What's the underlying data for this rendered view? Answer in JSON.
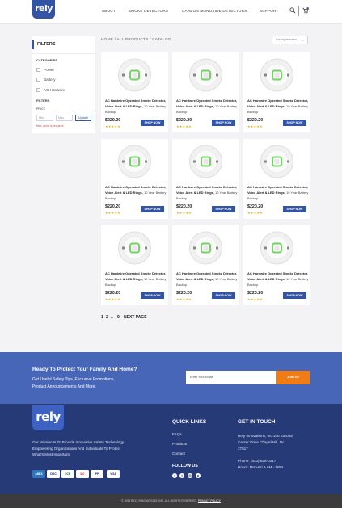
{
  "header": {
    "logo": "rely",
    "nav": [
      "ABOUT",
      "SMOKE DETECTORS",
      "CARBON MONOXIDE DETECTORS",
      "SUPPORT"
    ]
  },
  "sidebar": {
    "title": "FILTERS",
    "categories_label": "CATEGORIES",
    "categories": [
      "Power",
      "Battery",
      "AC Hardwire"
    ],
    "filters_label": "FILTERS",
    "price_label": "PRICE",
    "min_placeholder": "Min",
    "max_placeholder": "Max",
    "update_label": "Update",
    "price_error": "Max. price is required"
  },
  "breadcrumb": "HOME / ALL PRODUCTS / CATALOG",
  "sort": {
    "selected": "Sort by featured"
  },
  "products": [
    {
      "title": "AC Hardwire Operated Smoke Detector, Voice Alert & LED Rings,",
      "subtitle": "10 Year Battery Backup",
      "price": "$220.20",
      "stars": "★★★★★",
      "cta": "SHOP NOW"
    },
    {
      "title": "AC Hardwire Operated Smoke Detector, Voice Alert & LED Rings,",
      "subtitle": "10 Year Battery Backup",
      "price": "$220.20",
      "stars": "★★★★★",
      "cta": "SHOP NOW"
    },
    {
      "title": "AC Hardwire Operated Smoke Detector, Voice Alert & LED Rings,",
      "subtitle": "10 Year Battery Backup",
      "price": "$220.20",
      "stars": "★★★★★",
      "cta": "SHOP NOW"
    },
    {
      "title": "AC Hardwire Operated Smoke Detector, Voice Alert & LED Rings,",
      "subtitle": "10 Year Battery Backup",
      "price": "$220.20",
      "stars": "★★★★★",
      "cta": "SHOP NOW"
    },
    {
      "title": "AC Hardwire Operated Smoke Detector, Voice Alert & LED Rings,",
      "subtitle": "10 Year Battery Backup",
      "price": "$220.20",
      "stars": "★★★★★",
      "cta": "SHOP NOW"
    },
    {
      "title": "AC Hardwire Operated Smoke Detector, Voice Alert & LED Rings,",
      "subtitle": "10 Year Battery Backup",
      "price": "$220.20",
      "stars": "★★★★★",
      "cta": "SHOP NOW"
    },
    {
      "title": "AC Hardwire Operated Smoke Detector, Voice Alert & LED Rings,",
      "subtitle": "10 Year Battery Backup",
      "price": "$220.20",
      "stars": "★★★★★",
      "cta": "SHOP NOW"
    },
    {
      "title": "AC Hardwire Operated Smoke Detector, Voice Alert & LED Rings,",
      "subtitle": "10 Year Battery Backup",
      "price": "$220.20",
      "stars": "★★★★★",
      "cta": "SHOP NOW"
    },
    {
      "title": "AC Hardwire Operated Smoke Detector, Voice Alert & LED Rings,",
      "subtitle": "10 Year Battery Backup",
      "price": "$220.20",
      "stars": "★★★★★",
      "cta": "SHOP NOW"
    }
  ],
  "pagination": {
    "pages": [
      "1",
      "2",
      "..",
      "9"
    ],
    "next": "NEXT PAGE"
  },
  "newsletter": {
    "heading": "Ready To Protect Your Family And Home?",
    "line1": "Get Useful Safety Tips, Exclusive Promotions,",
    "line2": "Product Announcements And More.",
    "email_placeholder": "Enter Your Email",
    "button": "JOIN US"
  },
  "footer": {
    "logo": "rely",
    "mission": "Our Mission Is To Provide Innovative Safety Technology Empowering Organizations And Individuals To Protect What's Most Important.",
    "payments": [
      "AMEX",
      "DISC",
      "JCB",
      "MC",
      "PP",
      "VISA"
    ],
    "quick_links_title": "QUICK LINKS",
    "quick_links": [
      "FAQs",
      "Products",
      "Contact"
    ],
    "follow_title": "FOLLOW US",
    "touch_title": "GET IN TOUCH",
    "address1": "Rely Innovations, Inc.100 Europa",
    "address2": "Center Drive Chapel Hill, Nc",
    "address3": "27517",
    "phone": "Phone: (833) 625-0217",
    "hours": "Hours: Mon-Fri 9 AM - 5PM",
    "copyright": "© 2023 RELY INNOVATIONS, INC. ALL RIGHTS RESERVED.",
    "privacy": "PRIVACY POLICY"
  },
  "colors": {
    "brand": "#3354a4",
    "accent": "#f07c16",
    "footer": "#273a78",
    "led": "#6fd65c"
  }
}
